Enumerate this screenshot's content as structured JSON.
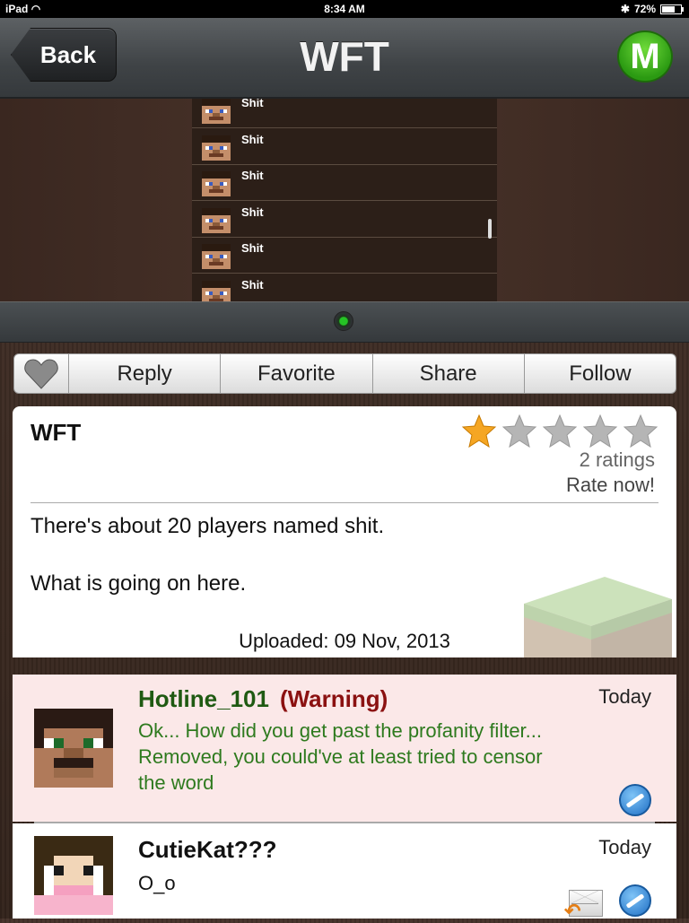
{
  "status_bar": {
    "device": "iPad",
    "time": "8:34 AM",
    "battery": "72%",
    "battery_level": 0.72
  },
  "nav": {
    "back_label": "Back",
    "title": "WFT",
    "m_label": "M"
  },
  "image": {
    "players": [
      {
        "name": "Shit"
      },
      {
        "name": "Shit"
      },
      {
        "name": "Shit"
      },
      {
        "name": "Shit"
      },
      {
        "name": "Shit"
      },
      {
        "name": "Shit"
      }
    ]
  },
  "actions": {
    "reply": "Reply",
    "favorite": "Favorite",
    "share": "Share",
    "follow": "Follow"
  },
  "post": {
    "title": "WFT",
    "rating": 1,
    "rating_max": 5,
    "ratings_count": "2 ratings",
    "rate_now": "Rate now!",
    "body_line1": "There's about 20 players named shit.",
    "body_line2": "What is going on here.",
    "uploaded": "Uploaded: 09 Nov, 2013"
  },
  "comments": [
    {
      "author": "Hotline_101",
      "tag": "(Warning)",
      "date": "Today",
      "text": "Ok... How did you get past the profanity filter... Removed, you could've at least tried to censor the word",
      "author_color": "#1f5a12",
      "text_color": "#2e7a1e",
      "background": "#fbe8e8"
    },
    {
      "author": "CutieKat???",
      "tag": "",
      "date": "Today",
      "text": "O_o",
      "author_color": "#111111",
      "text_color": "#111111",
      "background": "#ffffff"
    }
  ],
  "colors": {
    "star_filled": "#f5a623",
    "star_empty": "#b5b5b5",
    "warning": "#8b1111",
    "m_button": "#2b9a12"
  }
}
